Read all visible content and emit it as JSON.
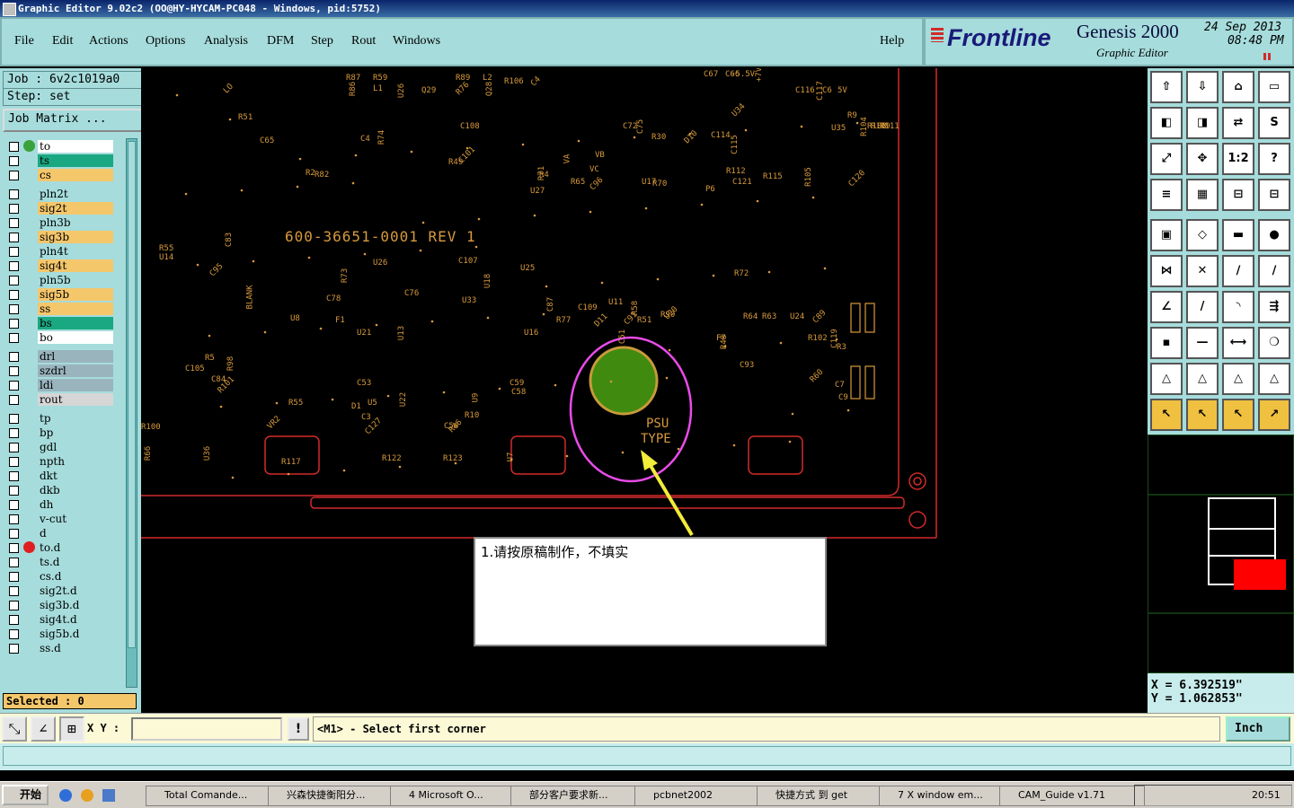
{
  "window": {
    "title": "Graphic Editor 9.02c2 (OO@HY-HYCAM-PC048 - Windows, pid:5752)"
  },
  "menu": {
    "items": [
      "File",
      "Edit",
      "Actions",
      "Options",
      "Analysis",
      "DFM",
      "Step",
      "Rout",
      "Windows"
    ],
    "help": "Help"
  },
  "brand": {
    "logo": "Frontline",
    "product": "Genesis 2000",
    "subtitle": "Graphic Editor",
    "date": "24 Sep 2013",
    "time": "08:48 PM"
  },
  "job": {
    "job_label": "Job : 6v2c1019a0",
    "step_label": "Step: set",
    "matrix_button": "Job Matrix ..."
  },
  "layers": [
    {
      "name": "to",
      "color": "#ffffff",
      "mark": "#3aa23a"
    },
    {
      "name": "ts",
      "color": "#1aa882"
    },
    {
      "name": "cs",
      "color": "#f5c76b"
    },
    {
      "name": "pln2t",
      "color": "#a6dcdc"
    },
    {
      "name": "sig2t",
      "color": "#f5c76b"
    },
    {
      "name": "pln3b",
      "color": "#a6dcdc"
    },
    {
      "name": "sig3b",
      "color": "#f5c76b"
    },
    {
      "name": "pln4t",
      "color": "#a6dcdc"
    },
    {
      "name": "sig4t",
      "color": "#f5c76b"
    },
    {
      "name": "pln5b",
      "color": "#a6dcdc"
    },
    {
      "name": "sig5b",
      "color": "#f5c76b"
    },
    {
      "name": "ss",
      "color": "#f5c76b"
    },
    {
      "name": "bs",
      "color": "#1aa882"
    },
    {
      "name": "bo",
      "color": "#ffffff"
    },
    {
      "name": "drl",
      "color": "#9ab4be"
    },
    {
      "name": "szdrl",
      "color": "#9ab4be"
    },
    {
      "name": "ldi",
      "color": "#9ab4be"
    },
    {
      "name": "rout",
      "color": "#d6d6d6"
    },
    {
      "name": "tp",
      "color": "#a6dcdc"
    },
    {
      "name": "bp",
      "color": "#a6dcdc"
    },
    {
      "name": "gdl",
      "color": "#a6dcdc"
    },
    {
      "name": "npth",
      "color": "#a6dcdc"
    },
    {
      "name": "dkt",
      "color": "#a6dcdc"
    },
    {
      "name": "dkb",
      "color": "#a6dcdc"
    },
    {
      "name": "dh",
      "color": "#a6dcdc"
    },
    {
      "name": "v-cut",
      "color": "#a6dcdc"
    },
    {
      "name": "d",
      "color": "#a6dcdc"
    },
    {
      "name": "to.d",
      "color": "#a6dcdc",
      "mark": "#e02020"
    },
    {
      "name": "ts.d",
      "color": "#a6dcdc"
    },
    {
      "name": "cs.d",
      "color": "#a6dcdc"
    },
    {
      "name": "sig2t.d",
      "color": "#a6dcdc"
    },
    {
      "name": "sig3b.d",
      "color": "#a6dcdc"
    },
    {
      "name": "sig4t.d",
      "color": "#a6dcdc"
    },
    {
      "name": "sig5b.d",
      "color": "#a6dcdc"
    },
    {
      "name": "ss.d",
      "color": "#a6dcdc"
    }
  ],
  "selected": "Selected : 0",
  "board": {
    "part_number": "600-36651-0001 REV 1",
    "psu_text": [
      "PSU",
      "TYPE"
    ],
    "note": "1.请按原稿制作，不填实",
    "labels": [
      "R87",
      "R86",
      "R89",
      "R76",
      "R106",
      "U26",
      "C67",
      "C66",
      "C116",
      "C117",
      "U34",
      "R9",
      "U35",
      "R104",
      "R108",
      "R109",
      "R111",
      "LO",
      "R51",
      "C65",
      "C4",
      "R74",
      "R49",
      "C108",
      "C101",
      "VA",
      "VB",
      "VC",
      "C72",
      "C75",
      "R30",
      "D10",
      "C114",
      "C115",
      "R112",
      "C121",
      "R115",
      "R105",
      "C120",
      "R2",
      "R82",
      "R71",
      "R4",
      "U27",
      "R65",
      "C96",
      "U17",
      "R70",
      "P6",
      "C83",
      "R55",
      "U14",
      "C95",
      "R73",
      "U26",
      "C107",
      "U25",
      "U18",
      "U11",
      "U20",
      "R72",
      "BLANK",
      "C78",
      "C76",
      "U33",
      "C87",
      "C91",
      "R51",
      "C109",
      "R58",
      "R64",
      "R63",
      "U24",
      "C89",
      "U8",
      "F1",
      "U21",
      "U13",
      "U16",
      "R77",
      "D11",
      "C51",
      "R90",
      "F7",
      "R102",
      "C119",
      "R3",
      "R60",
      "C93",
      "R48",
      "C105",
      "R5",
      "C84",
      "R98",
      "R101",
      "C53",
      "U5",
      "U9",
      "C59",
      "C58",
      "R10",
      "R46",
      "C7",
      "C9",
      "D1",
      "U22",
      "R55",
      "C3",
      "C127",
      "U36",
      "R117",
      "R122",
      "R123",
      "U7",
      "C56",
      "VR2",
      "R100",
      "R66",
      "R59",
      "L1",
      "L2",
      "Q28",
      "C4",
      "Q29",
      "-5.5V",
      "+7V",
      "C6",
      "5V"
    ]
  },
  "coords": {
    "x": "X = 6.392519\"",
    "y": "Y = 1.062853\""
  },
  "cmd": {
    "xy_label": "X Y :",
    "xy_value": "",
    "prompt": "<M1> - Select first corner",
    "unit": "Inch"
  },
  "taskbar": {
    "start": "开始",
    "tasks": [
      "Total Comande...",
      "兴森快捷衡阳分...",
      "4 Microsoft O...",
      "部分客户要求新...",
      "pcbnet2002",
      "快捷方式 到 get",
      "7 X window em...",
      "CAM_Guide v1.71"
    ],
    "clock": "20:51"
  },
  "colors": {
    "panel": "#a6dcdc",
    "board_outline": "#d22a2a",
    "silk": "#d89a3c",
    "psu_pad": "#3f8a0f",
    "note_arrow": "#f2ec3a",
    "highlight_circle": "#e84be8"
  }
}
